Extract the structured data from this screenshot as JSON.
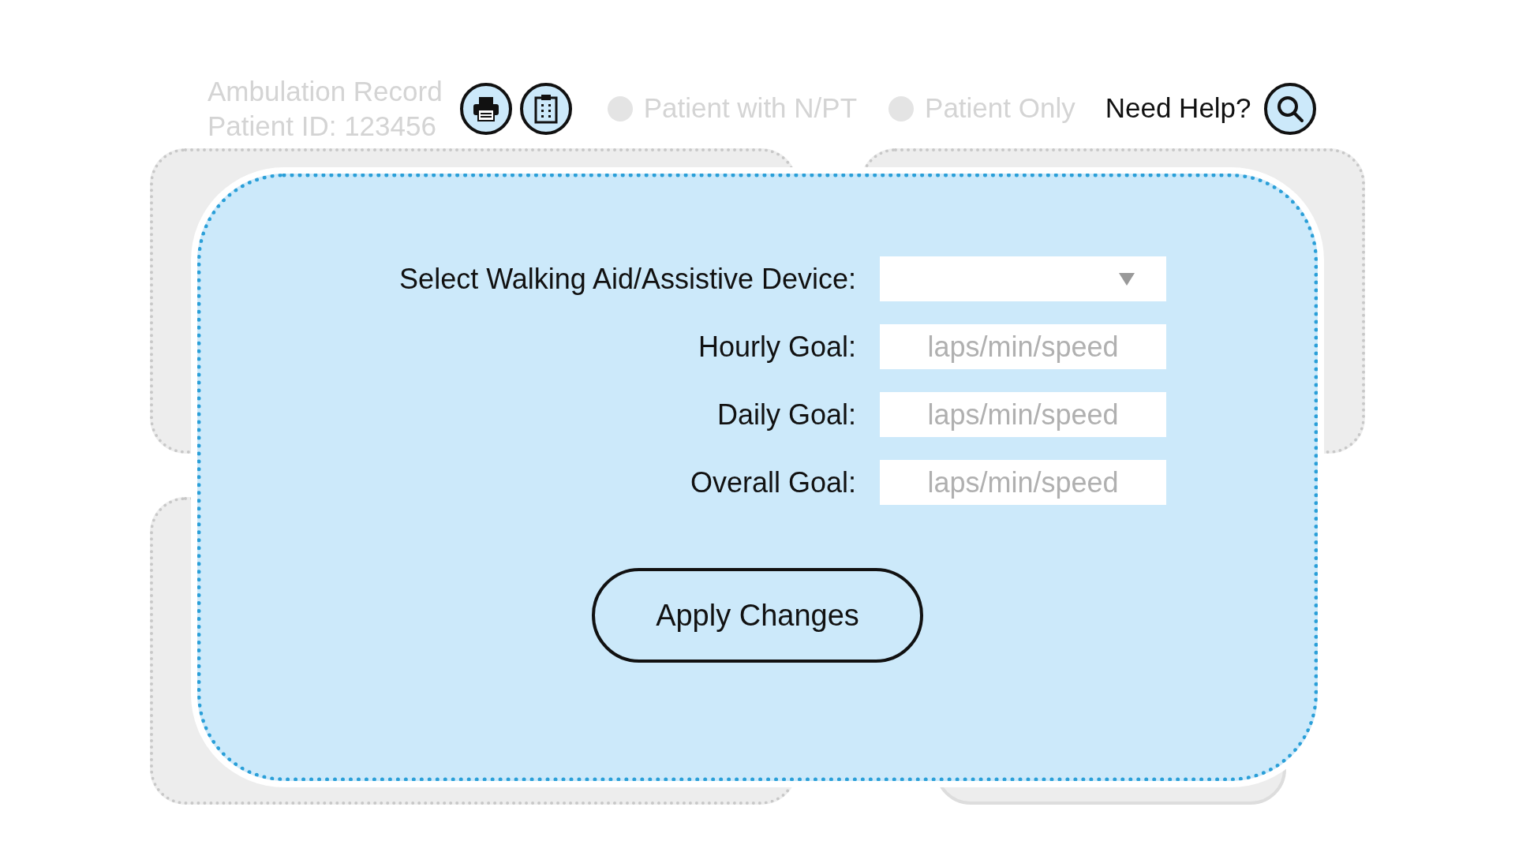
{
  "header": {
    "title": "Ambulation Record",
    "patient_id": "Patient ID: 123456",
    "help": "Need Help?"
  },
  "patient_options": [
    {
      "label": "Patient with N/PT",
      "selected": false,
      "disabled": true
    },
    {
      "label": "Patient Only",
      "selected": false,
      "disabled": true
    }
  ],
  "form": {
    "fields": [
      {
        "kind": "select",
        "label": "Select Walking Aid/Assistive Device:"
      },
      {
        "kind": "input",
        "label": "Hourly Goal:",
        "placeholder": "laps/min/speed"
      },
      {
        "kind": "input",
        "label": "Daily Goal:",
        "placeholder": "laps/min/speed"
      },
      {
        "kind": "input",
        "label": "Overall Goal:",
        "placeholder": "laps/min/speed"
      }
    ],
    "button": "Apply Changes"
  }
}
